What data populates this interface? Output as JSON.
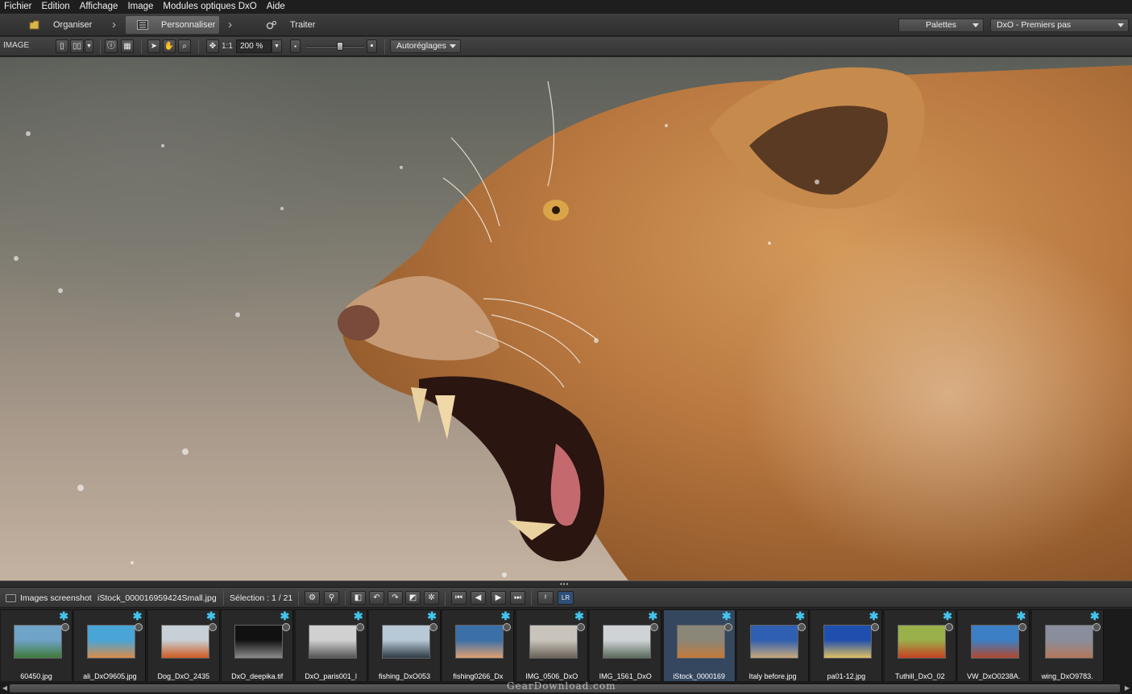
{
  "menu": [
    "Fichier",
    "Edition",
    "Affichage",
    "Image",
    "Modules optiques DxO",
    "Aide"
  ],
  "modes": {
    "organise": "Organiser",
    "customise": "Personnaliser",
    "process": "Traiter"
  },
  "palettes_label": "Palettes",
  "workspace_label": "DxO - Premiers pas",
  "toolbar": {
    "section_label": "IMAGE",
    "one_to_one": "1:1",
    "zoom": "200 %",
    "presets_label": "Autoréglages"
  },
  "filmstrip_header": {
    "project": "Images screenshot",
    "filename": "iStock_000016959424Small.jpg",
    "selection": "Sélection : 1 / 21"
  },
  "thumbnails": [
    {
      "caption": "60450.jpg",
      "colors": [
        "#6fa3c7",
        "#3f7a3a"
      ],
      "selected": false
    },
    {
      "caption": "ali_DxO9605.jpg",
      "colors": [
        "#48a5d6",
        "#d98b4a"
      ],
      "selected": false
    },
    {
      "caption": "Dog_DxO_2435",
      "colors": [
        "#c7d0d6",
        "#d05a20"
      ],
      "selected": false
    },
    {
      "caption": "DxO_deepika.tif",
      "colors": [
        "#111111",
        "#8a8a8a"
      ],
      "selected": false
    },
    {
      "caption": "DxO_paris001_l",
      "colors": [
        "#d0d0d0",
        "#555555"
      ],
      "selected": false
    },
    {
      "caption": "fishing_DxO053",
      "colors": [
        "#b7c8d6",
        "#2e3a44"
      ],
      "selected": false
    },
    {
      "caption": "fishing0266_Dx",
      "colors": [
        "#3a6fa8",
        "#e0a070"
      ],
      "selected": false
    },
    {
      "caption": "IMG_0506_DxO",
      "colors": [
        "#c8c4bc",
        "#6a6258"
      ],
      "selected": false
    },
    {
      "caption": "IMG_1561_DxO",
      "colors": [
        "#cfd3d6",
        "#5a6a5c"
      ],
      "selected": false
    },
    {
      "caption": "iStock_0000169",
      "colors": [
        "#8a8678",
        "#c47a3a"
      ],
      "selected": true
    },
    {
      "caption": "Italy before.jpg",
      "colors": [
        "#2f5fb0",
        "#c9a87a"
      ],
      "selected": false
    },
    {
      "caption": "pa01-12.jpg",
      "colors": [
        "#1f4fae",
        "#e0c060"
      ],
      "selected": false
    },
    {
      "caption": "Tuthill_DxO_02",
      "colors": [
        "#9ab04a",
        "#c84020"
      ],
      "selected": false
    },
    {
      "caption": "VW_DxO0238A.",
      "colors": [
        "#3c7fc4",
        "#b04830"
      ],
      "selected": false
    },
    {
      "caption": "wing_DxO9783.",
      "colors": [
        "#8a8e9c",
        "#b4785c"
      ],
      "selected": false
    }
  ],
  "watermark": "GearDownload.com",
  "accent_color": "#43c6ee"
}
